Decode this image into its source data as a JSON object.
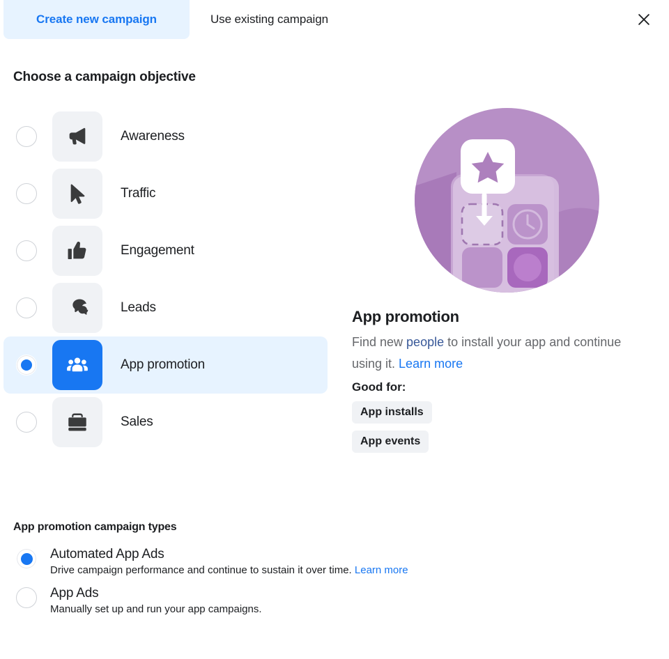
{
  "tabs": {
    "create": "Create new campaign",
    "existing": "Use existing campaign",
    "close_icon": "close-icon"
  },
  "objective_section": {
    "title": "Choose a campaign objective",
    "items": [
      {
        "label": "Awareness",
        "icon": "megaphone-icon",
        "selected": false
      },
      {
        "label": "Traffic",
        "icon": "cursor-arrow-icon",
        "selected": false
      },
      {
        "label": "Engagement",
        "icon": "thumbs-up-icon",
        "selected": false
      },
      {
        "label": "Leads",
        "icon": "speech-bubbles-icon",
        "selected": false
      },
      {
        "label": "App promotion",
        "icon": "people-group-icon",
        "selected": true
      },
      {
        "label": "Sales",
        "icon": "briefcase-icon",
        "selected": false
      }
    ]
  },
  "detail": {
    "illustration": "app-install-illustration",
    "title": "App promotion",
    "desc_part1": "Find new ",
    "desc_link1": "people",
    "desc_part2": " to install your app and continue using it. ",
    "desc_link2": "Learn more",
    "good_for_label": "Good for:",
    "tags": [
      "App installs",
      "App events"
    ]
  },
  "campaign_types": {
    "title": "App promotion campaign types",
    "items": [
      {
        "name": "Automated App Ads",
        "desc": "Drive campaign performance and continue to sustain it over time. ",
        "link": "Learn more",
        "selected": true
      },
      {
        "name": "App Ads",
        "desc": "Manually set up and run your app campaigns.",
        "link": "",
        "selected": false
      }
    ]
  },
  "colors": {
    "accent_blue": "#1877f2",
    "tab_active_bg": "#e7f3ff",
    "tile_gray": "#f0f2f5",
    "body_gray": "#65676b"
  }
}
